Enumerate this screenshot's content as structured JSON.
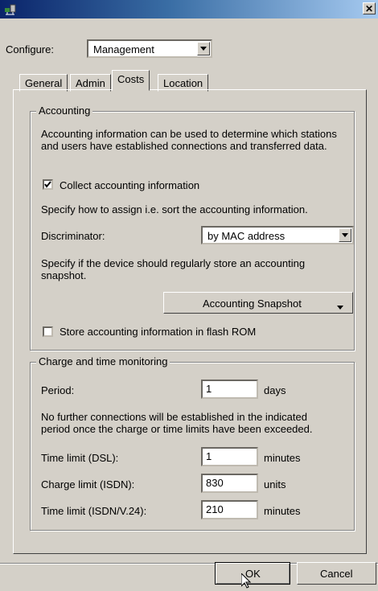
{
  "window": {
    "close_glyph": "✕",
    "icon": "network-app-icon"
  },
  "configure": {
    "label": "Configure:",
    "value": "Management"
  },
  "tabs": [
    {
      "label": "General",
      "active": false
    },
    {
      "label": "Admin",
      "active": false
    },
    {
      "label": "Costs",
      "active": true
    },
    {
      "label": "Location",
      "active": false
    }
  ],
  "accounting": {
    "legend": "Accounting",
    "description": "Accounting information can be used to determine which stations and users have established connections and transferred data.",
    "collect_label": "Collect accounting information",
    "collect_checked": true,
    "assign_text": "Specify how to assign i.e. sort the accounting information.",
    "discriminator_label": "Discriminator:",
    "discriminator_value": "by MAC address",
    "snapshot_text": "Specify if the device should regularly store an accounting snapshot.",
    "snapshot_button": "Accounting Snapshot",
    "flash_label": "Store accounting information in flash ROM",
    "flash_checked": false
  },
  "charge": {
    "legend": "Charge and time monitoring",
    "period_label": "Period:",
    "period_value": "1",
    "period_unit": "days",
    "note": "No further connections will be established in the indicated period once the charge or time limits have been exceeded.",
    "dsl_label": "Time limit (DSL):",
    "dsl_value": "1",
    "dsl_unit": "minutes",
    "isdn_charge_label": "Charge limit (ISDN):",
    "isdn_charge_value": "830",
    "isdn_charge_unit": "units",
    "isdn_time_label": "Time limit (ISDN/V.24):",
    "isdn_time_value": "210",
    "isdn_time_unit": "minutes"
  },
  "buttons": {
    "ok": "OK",
    "cancel": "Cancel"
  }
}
